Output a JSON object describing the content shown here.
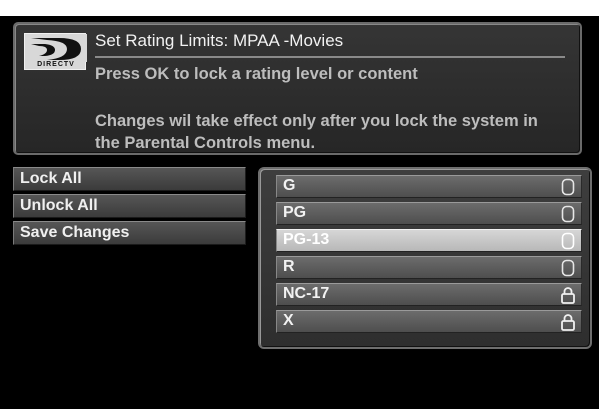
{
  "top_caption": "",
  "header": {
    "logo_text": "DIRECTV",
    "title": "Set Rating Limits: MPAA -Movies",
    "instruction": "Press OK to lock a rating level or content",
    "note": "Changes wil take effect only after you lock the system in the Parental Controls menu."
  },
  "menu": {
    "items": [
      {
        "label": "Lock All"
      },
      {
        "label": "Unlock All"
      },
      {
        "label": "Save Changes"
      }
    ]
  },
  "ratings": {
    "selected": "PG-13",
    "items": [
      {
        "label": "G",
        "locked": false,
        "icon": "unlocked-icon"
      },
      {
        "label": "PG",
        "locked": false,
        "icon": "unlocked-icon"
      },
      {
        "label": "PG-13",
        "locked": false,
        "icon": "unlocked-icon"
      },
      {
        "label": "R",
        "locked": false,
        "icon": "unlocked-icon"
      },
      {
        "label": "NC-17",
        "locked": true,
        "icon": "lock-icon"
      },
      {
        "label": "X",
        "locked": true,
        "icon": "lock-icon"
      }
    ]
  },
  "colors": {
    "background": "#000000",
    "panel": "#2e2e2e",
    "row": "#5a5a5a",
    "row_selected": "#c8c8c8",
    "text": "#f0f0f0"
  }
}
